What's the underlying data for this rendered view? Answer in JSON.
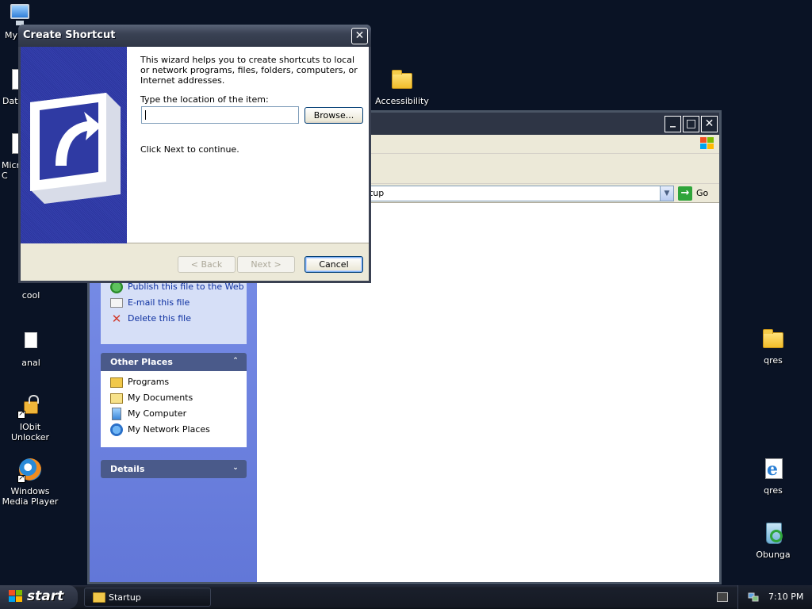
{
  "desktop": {
    "icons": [
      {
        "label": "My",
        "icon": "my-computer-icon"
      },
      {
        "label": "Dat",
        "icon": "document-icon"
      },
      {
        "label": "Micr\nC",
        "icon": "document-icon"
      },
      {
        "label": "cool",
        "icon": "document-icon"
      },
      {
        "label": "anal",
        "icon": "document-icon"
      },
      {
        "label": "IObit Unlocker",
        "icon": "lock-icon"
      },
      {
        "label": "Windows Media Player",
        "icon": "media-player-icon"
      },
      {
        "label": "Accessibility",
        "icon": "folder-icon"
      },
      {
        "label": "qres",
        "icon": "folder-icon"
      },
      {
        "label": "qres",
        "icon": "internet-explorer-icon"
      },
      {
        "label": "Obunga",
        "icon": "recycle-bin-icon"
      }
    ]
  },
  "explorer": {
    "address_value": "tup",
    "go_label": "Go",
    "file_tasks": [
      {
        "label": "Publish this file to the Web",
        "icon": "publish-web-icon"
      },
      {
        "label": "E-mail this file",
        "icon": "email-icon"
      },
      {
        "label": "Delete this file",
        "icon": "delete-icon"
      }
    ],
    "other_places": {
      "title": "Other Places",
      "items": [
        {
          "label": "Programs",
          "icon": "programs-folder-icon"
        },
        {
          "label": "My Documents",
          "icon": "my-documents-icon"
        },
        {
          "label": "My Computer",
          "icon": "my-computer-icon"
        },
        {
          "label": "My Network Places",
          "icon": "network-places-icon"
        }
      ]
    },
    "details": {
      "title": "Details"
    },
    "title_buttons": {
      "minimize": "_",
      "maximize": "□",
      "close": "✕"
    }
  },
  "dialog": {
    "title": "Create Shortcut",
    "close_glyph": "✕",
    "intro": "This wizard helps you to create shortcuts to local or network programs, files, folders, computers, or Internet addresses.",
    "location_label": "Type the location of the item:",
    "location_value": "",
    "browse_label": "Browse...",
    "continue_text": "Click Next to continue.",
    "back_label": "< Back",
    "next_label": "Next >",
    "cancel_label": "Cancel"
  },
  "taskbar": {
    "start_label": "start",
    "task_button_label": "Startup",
    "clock": "7:10 PM"
  },
  "colors": {
    "desktop_bg": "#0a1325",
    "dialog_face": "#ece9d8",
    "wizard_banner": "#2f3aa3",
    "task_link": "#0c2fa0",
    "panel_header_text": "#215dc6"
  }
}
